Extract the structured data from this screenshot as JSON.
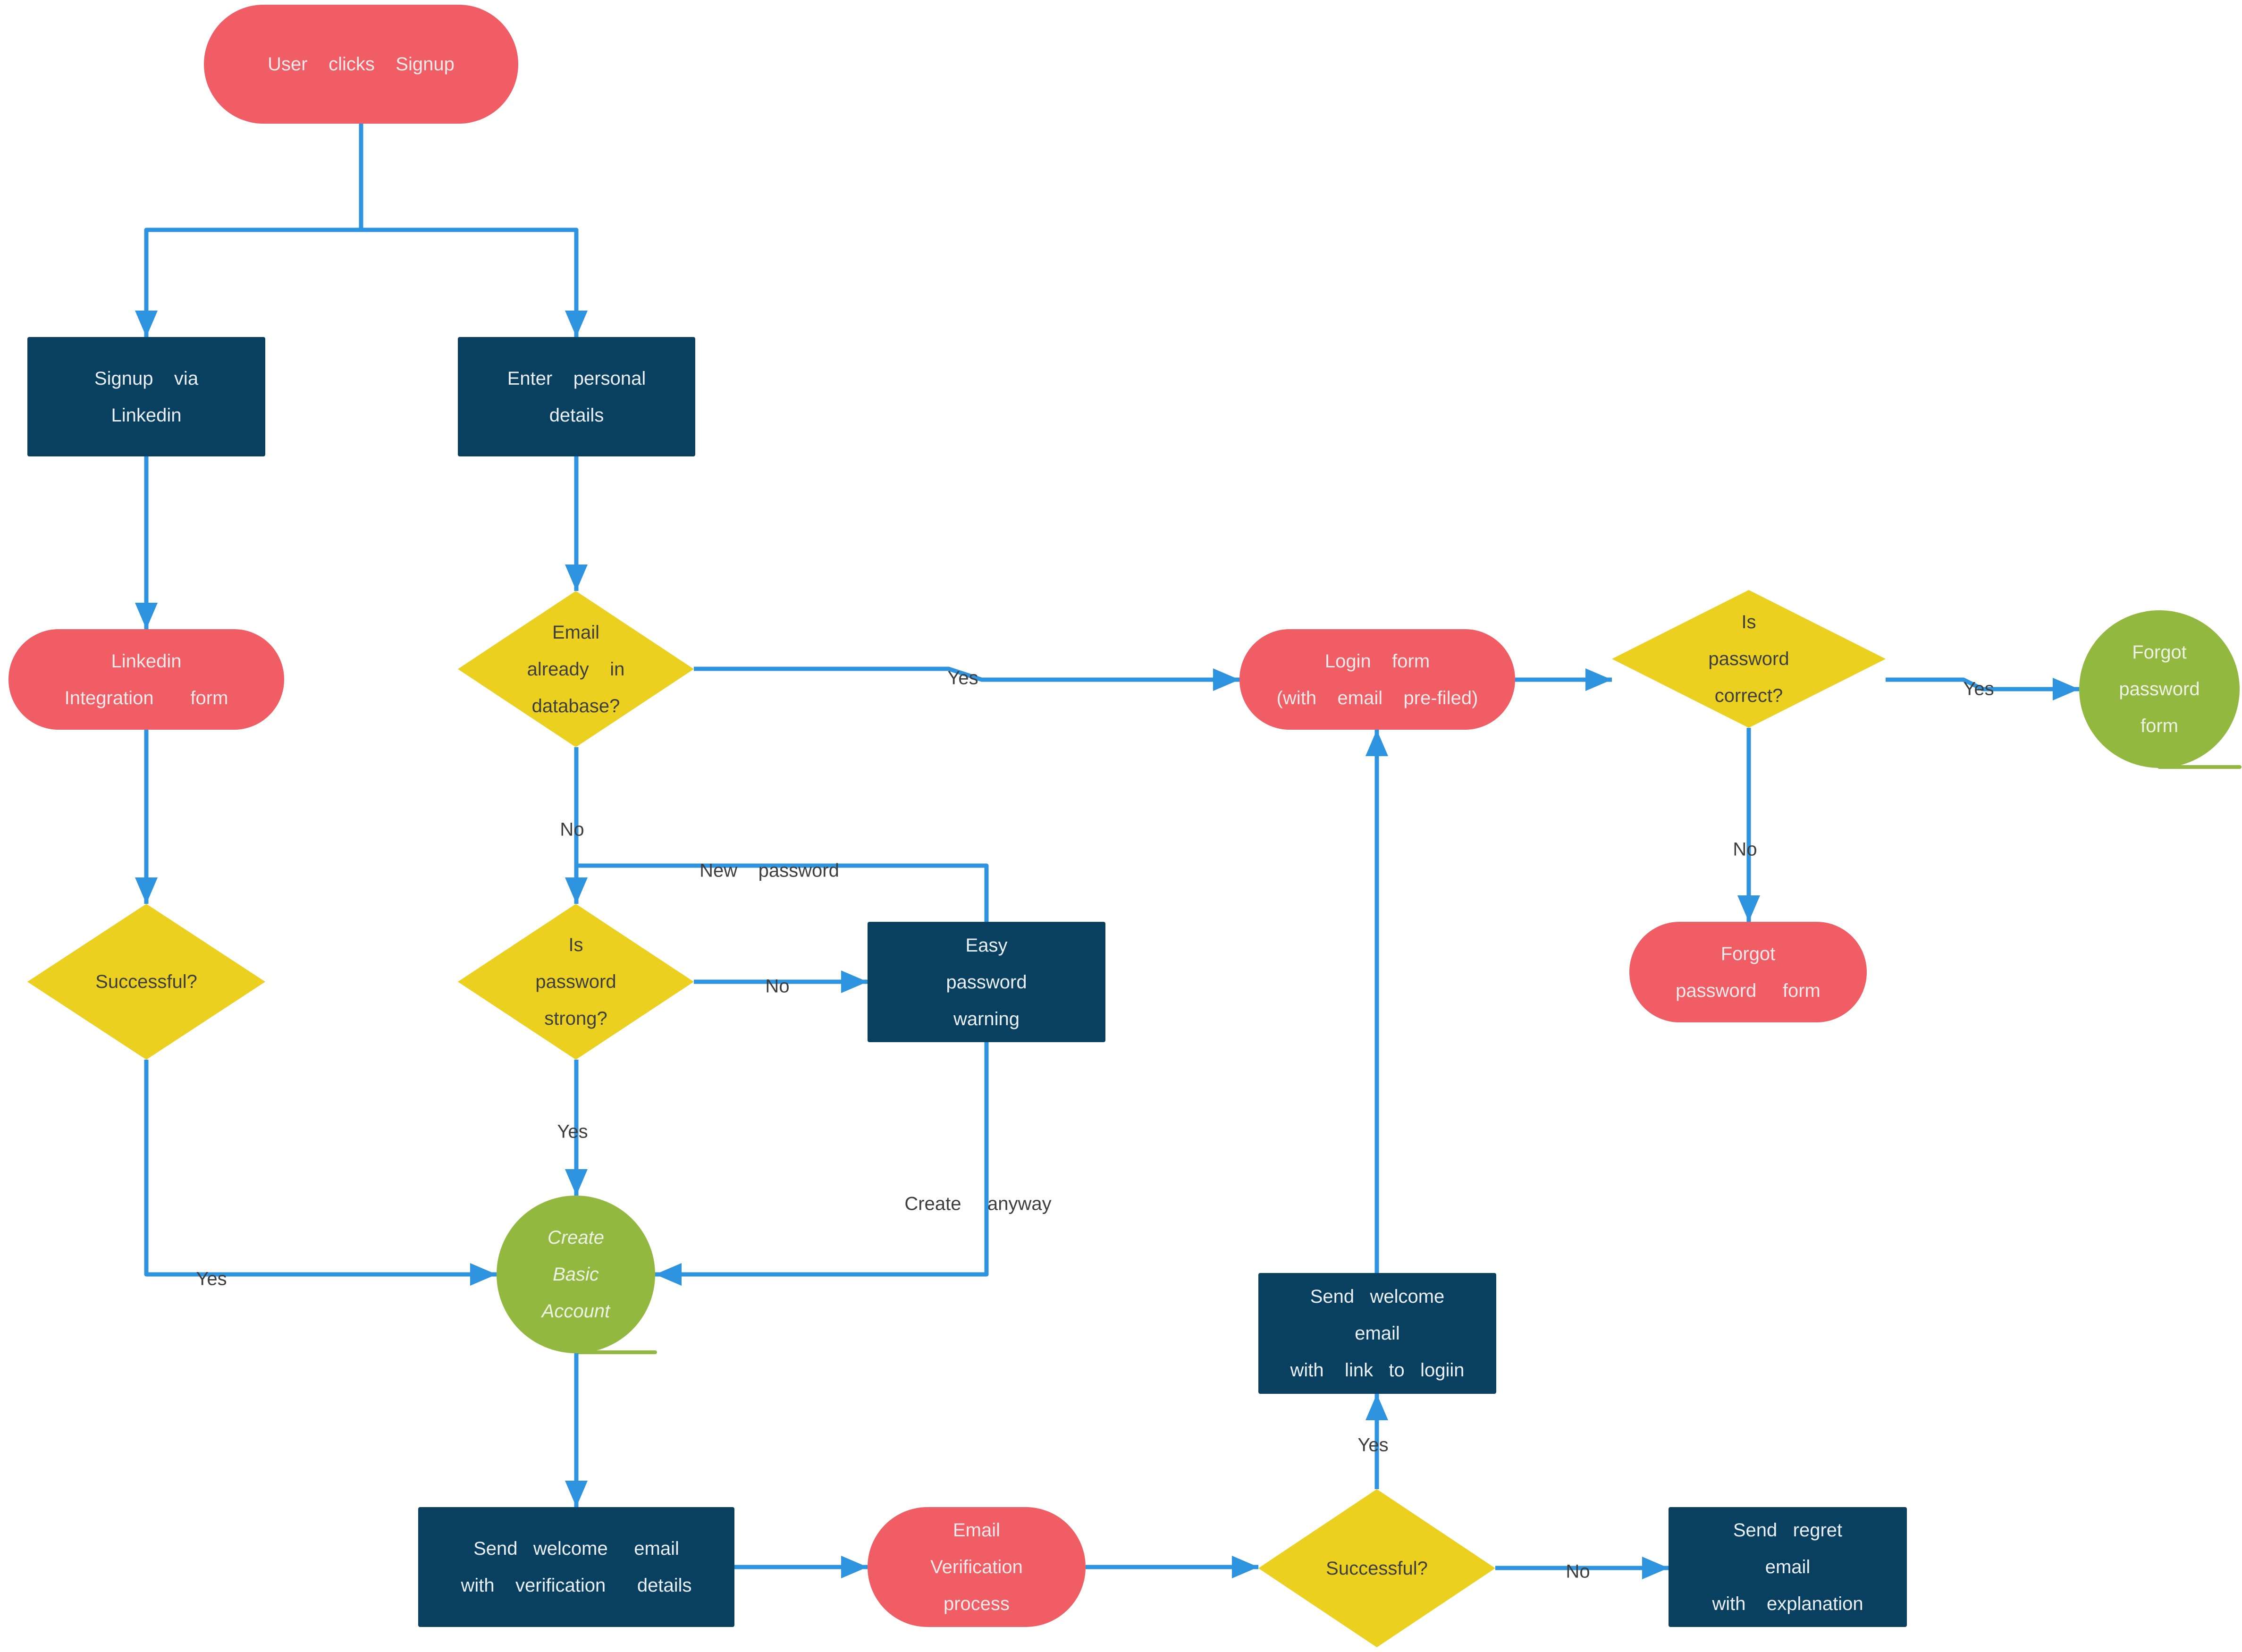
{
  "colors": {
    "terminal": "#f05d64",
    "process": "#09405f",
    "decision": "#ebd020",
    "circle": "#93b840",
    "connector": "#2f94e0",
    "label_text": "#3e3e3e"
  },
  "nodes": {
    "user_clicks_signup": {
      "lines": [
        "User    clicks    Signup"
      ],
      "shape": "terminal"
    },
    "signup_via_linkedin": {
      "lines": [
        "Signup    via",
        "Linkedin"
      ],
      "shape": "process"
    },
    "enter_personal_details": {
      "lines": [
        "Enter    personal",
        "details"
      ],
      "shape": "process"
    },
    "linkedin_integration_form": {
      "lines": [
        "Linkedin",
        "Integration       form"
      ],
      "shape": "terminal"
    },
    "email_in_database": {
      "lines": [
        "Email",
        "already    in",
        "database?"
      ],
      "shape": "decision"
    },
    "linkedin_successful": {
      "lines": [
        "Successful?"
      ],
      "shape": "decision"
    },
    "password_strong": {
      "lines": [
        "Is",
        "password",
        "strong?"
      ],
      "shape": "decision"
    },
    "easy_password_warning": {
      "lines": [
        "Easy",
        "password",
        "warning"
      ],
      "shape": "process"
    },
    "create_basic_account": {
      "lines": [
        "Create",
        "Basic",
        "Account"
      ],
      "shape": "circle"
    },
    "send_welcome_verification": {
      "lines": [
        "Send   welcome     email",
        "with    verification      details"
      ],
      "shape": "process"
    },
    "email_verification_process": {
      "lines": [
        "Email",
        "Verification",
        "process"
      ],
      "shape": "terminal"
    },
    "verification_successful": {
      "lines": [
        "Successful?"
      ],
      "shape": "decision"
    },
    "send_regret_email": {
      "lines": [
        "Send   regret",
        "email",
        "with    explanation"
      ],
      "shape": "process"
    },
    "send_welcome_login": {
      "lines": [
        "Send   welcome",
        "email",
        "with    link   to   logiin"
      ],
      "shape": "process"
    },
    "login_form": {
      "lines": [
        "Login    form",
        "(with    email    pre-filed)"
      ],
      "shape": "terminal"
    },
    "password_correct": {
      "lines": [
        "Is",
        "password",
        "correct?"
      ],
      "shape": "decision"
    },
    "forgot_password_form_green": {
      "lines": [
        "Forgot",
        "password",
        "form"
      ],
      "shape": "circle"
    },
    "forgot_password_form_red": {
      "lines": [
        "Forgot",
        "password     form"
      ],
      "shape": "terminal"
    }
  },
  "edge_labels": {
    "email_db_yes": "Yes",
    "email_db_no": "No",
    "new_password": "New    password",
    "strong_no": "No",
    "strong_yes": "Yes",
    "create_anyway": "Create     anyway",
    "linkedin_yes": "Yes",
    "verify_yes": "Yes",
    "verify_no": "No",
    "correct_yes": "Yes",
    "correct_no": "No"
  }
}
